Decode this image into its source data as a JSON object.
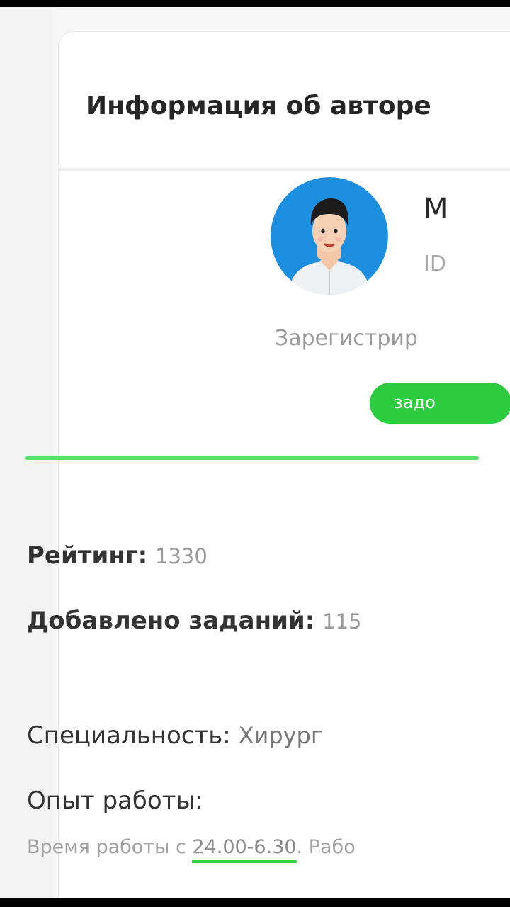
{
  "card": {
    "title": "Информация об авторе"
  },
  "author": {
    "name": "M",
    "id": "ID",
    "registered": "Зарегистрир",
    "role_badge": "задо"
  },
  "stats": {
    "rating_label": "Рейтинг:",
    "rating_value": "1330",
    "tasks_label": "Добавлено заданий:",
    "tasks_value": "115",
    "specialty_label": "Специальность:",
    "specialty_value": "Хирург",
    "experience_label": "Опыт работы:"
  },
  "schedule": {
    "prefix": "Время работы с ",
    "hours": "24.00-6.30",
    "suffix": ". Рабо"
  },
  "colors": {
    "accent_green": "#2ccc3e",
    "divider_green": "#5ae06a",
    "avatar_bg": "#1d8fe0"
  },
  "icons": {
    "avatar": "user-avatar-illustration"
  }
}
